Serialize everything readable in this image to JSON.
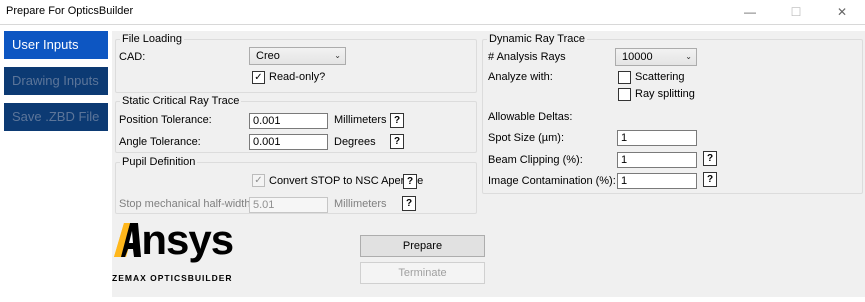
{
  "window": {
    "title": "Prepare For OpticsBuilder",
    "minimize_glyph": "—",
    "maximize_glyph": "☐",
    "close_glyph": "✕"
  },
  "sidebar": {
    "items": [
      {
        "label": "User Inputs",
        "active": true
      },
      {
        "label": "Drawing Inputs",
        "active": false
      },
      {
        "label": "Save .ZBD File",
        "active": false
      }
    ]
  },
  "file_loading": {
    "title": "File Loading",
    "cad_label": "CAD:",
    "cad_value": "Creo",
    "read_only_label": "Read-only?",
    "read_only_checked": true
  },
  "static_trace": {
    "title": "Static Critical Ray Trace",
    "position_label": "Position Tolerance:",
    "position_value": "0.001",
    "position_unit": "Millimeters",
    "angle_label": "Angle Tolerance:",
    "angle_value": "0.001",
    "angle_unit": "Degrees",
    "help_glyph": "?"
  },
  "pupil": {
    "title": "Pupil Definition",
    "convert_label": "Convert STOP to NSC Aperture",
    "convert_checked": true,
    "halfwidth_label": "Stop mechanical half-width",
    "halfwidth_value": "5.01",
    "halfwidth_unit": "Millimeters"
  },
  "dynamic_trace": {
    "title": "Dynamic Ray Trace",
    "rays_label": "# Analysis Rays",
    "rays_value": "10000",
    "analyze_label": "Analyze with:",
    "scattering_label": "Scattering",
    "scattering_checked": false,
    "splitting_label": "Ray splitting",
    "splitting_checked": false,
    "deltas_label": "Allowable Deltas:",
    "spot_label": "Spot Size (µm):",
    "spot_value": "1",
    "clipping_label": "Beam Clipping (%):",
    "clipping_value": "1",
    "contamination_label": "Image Contamination (%):",
    "contamination_value": "1"
  },
  "actions": {
    "prepare_label": "Prepare",
    "terminate_label": "Terminate"
  },
  "logo": {
    "wordmark": "Ansys",
    "subtitle": "ZEMAX OPTICSBUILDER",
    "accent_color": "#ffb71b"
  }
}
